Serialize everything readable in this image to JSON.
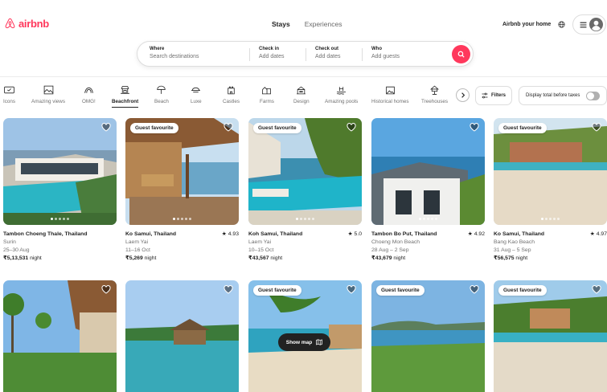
{
  "header": {
    "logo_text": "airbnb",
    "tabs": [
      {
        "label": "Stays"
      },
      {
        "label": "Experiences"
      }
    ],
    "host_link": "Airbnb your home"
  },
  "search": {
    "where": {
      "label": "Where",
      "placeholder": "Search destinations"
    },
    "checkin": {
      "label": "Check in",
      "placeholder": "Add dates"
    },
    "checkout": {
      "label": "Check out",
      "placeholder": "Add dates"
    },
    "who": {
      "label": "Who",
      "placeholder": "Add guests"
    }
  },
  "categories": [
    {
      "label": "Icons",
      "icon": "icons-icon"
    },
    {
      "label": "Amazing views",
      "icon": "amazing-views-icon"
    },
    {
      "label": "OMG!",
      "icon": "omg-icon"
    },
    {
      "label": "Beachfront",
      "icon": "beachfront-icon"
    },
    {
      "label": "Beach",
      "icon": "beach-icon"
    },
    {
      "label": "Luxe",
      "icon": "luxe-icon"
    },
    {
      "label": "Castles",
      "icon": "castles-icon"
    },
    {
      "label": "Farms",
      "icon": "farms-icon"
    },
    {
      "label": "Design",
      "icon": "design-icon"
    },
    {
      "label": "Amazing pools",
      "icon": "amazing-pools-icon"
    },
    {
      "label": "Historical homes",
      "icon": "historical-homes-icon"
    },
    {
      "label": "Treehouses",
      "icon": "treehouses-icon"
    }
  ],
  "filters_label": "Filters",
  "tax_toggle_label": "Display total before taxes",
  "listings": [
    {
      "title": "Tambon Choeng Thale, Thailand",
      "rating": "",
      "location": "Surin",
      "dates": "25–30 Aug",
      "price": "₹5,13,531",
      "price_unit": "night",
      "badge": ""
    },
    {
      "title": "Ko Samui, Thailand",
      "rating": "★ 4.93",
      "location": "Laem Yai",
      "dates": "11–16 Oct",
      "price": "₹5,269",
      "price_unit": "night",
      "badge": "Guest favourite"
    },
    {
      "title": "Koh Samui, Thailand",
      "rating": "★ 5.0",
      "location": "Laem Yai",
      "dates": "10–15 Oct",
      "price": "₹43,567",
      "price_unit": "night",
      "badge": "Guest favourite"
    },
    {
      "title": "Tambon Bo Put, Thailand",
      "rating": "★ 4.92",
      "location": "Choeng Mon Beach",
      "dates": "28 Aug – 2 Sep",
      "price": "₹43,679",
      "price_unit": "night",
      "badge": ""
    },
    {
      "title": "Ko Samui, Thailand",
      "rating": "★ 4.97",
      "location": "Bang Kao Beach",
      "dates": "31 Aug – 5 Sep",
      "price": "₹56,575",
      "price_unit": "night",
      "badge": "Guest favourite"
    }
  ],
  "listings_row2": [
    {
      "badge": ""
    },
    {
      "badge": ""
    },
    {
      "badge": "Guest favourite"
    },
    {
      "badge": "Guest favourite"
    },
    {
      "badge": "Guest favourite"
    }
  ],
  "show_map_label": "Show map",
  "colors": {
    "brand": "#ff385c",
    "text": "#222222",
    "muted": "#717171",
    "border": "#dddddd"
  }
}
